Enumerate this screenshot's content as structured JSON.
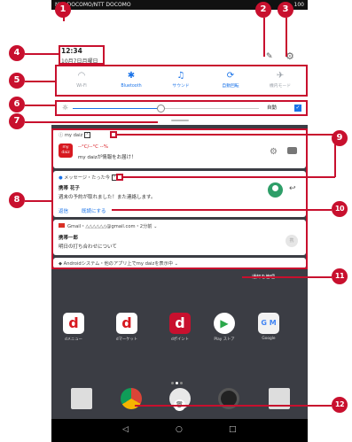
{
  "status_bar": {
    "carrier": "NTT DOCOMO/NTT DOCOMO",
    "right": "100"
  },
  "header": {
    "time": "12:34",
    "date": "10月7日月曜日"
  },
  "quick_settings": [
    {
      "label": "Wi-Fi",
      "icon": "wifi-icon",
      "state": "off",
      "glyph": "◠"
    },
    {
      "label": "Bluetooth",
      "icon": "bluetooth-icon",
      "state": "on",
      "glyph": "✱"
    },
    {
      "label": "サウンド",
      "icon": "bell-icon",
      "state": "on",
      "glyph": "♫"
    },
    {
      "label": "自動回転",
      "icon": "rotate-icon",
      "state": "on",
      "glyph": "⟳"
    },
    {
      "label": "機内モード",
      "icon": "airplane-icon",
      "state": "off",
      "glyph": "✈"
    }
  ],
  "brightness": {
    "level": 0.47,
    "auto_label": "自動"
  },
  "notifications": {
    "daiz": {
      "app": "my daiz",
      "logo_top": "my",
      "logo_bottom": "daiz",
      "line1": "--°C/--°C --%",
      "line2": "my daizが情報をお届け！"
    },
    "message": {
      "app": "メッセージ・たった今",
      "sender": "携帯 花子",
      "body": "週末の予約が取れました！また連絡します。",
      "action_reply": "返信",
      "action_read": "既読にする"
    },
    "gmail": {
      "header": "Gmail・△△△△△△@gmail.com・2分前",
      "sender": "携帯一郎",
      "subject": "明日の打ち合わせについて",
      "avatar": "携"
    },
    "system": {
      "text": "Androidシステム・他のアプリ上でmy daizを表示中"
    }
  },
  "manage_label": "通知を管理",
  "home_apps": [
    {
      "name": "dメニュー",
      "color": "#ffffff"
    },
    {
      "name": "dマーケット",
      "color": "#ffffff"
    },
    {
      "name": "dポイント",
      "color": "#c8102e"
    },
    {
      "name": "Play ストア",
      "color": "#ffffff"
    },
    {
      "name": "Google",
      "color": "#f2f2f2"
    }
  ],
  "annotations": [
    "1",
    "2",
    "3",
    "4",
    "5",
    "6",
    "7",
    "8",
    "9",
    "10",
    "11",
    "12"
  ],
  "accent_color": "#c8102e"
}
